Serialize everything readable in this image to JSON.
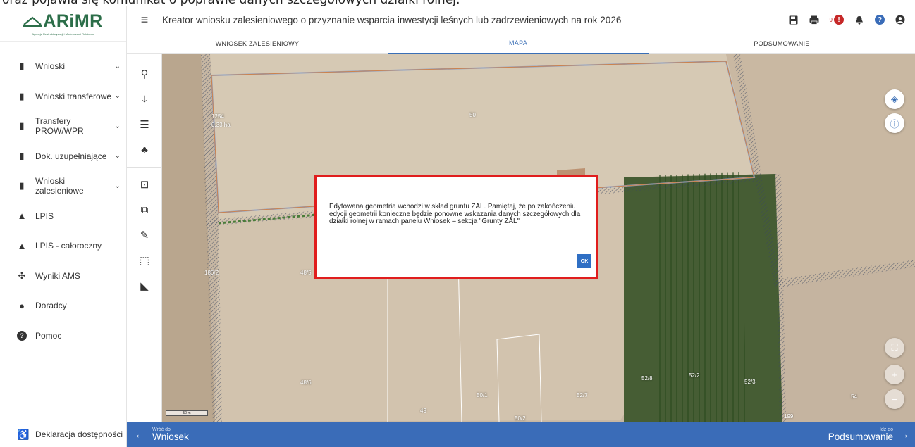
{
  "caption": "oraz pojawia się komunikat o poprawie danych szczegółowych działki rolnej:",
  "logo": {
    "name": "ARiMR",
    "subtitle": "Agencja Restrukturyzacji i Modernizacji Rolnictwa"
  },
  "header": {
    "title": "Kreator wniosku zalesieniowego o przyznanie wsparcia inwestycji leśnych lub zadrzewieniowych na rok 2026",
    "notification_count": "9"
  },
  "tabs": [
    {
      "label": "WNIOSEK ZALESIENIOWY",
      "active": false
    },
    {
      "label": "MAPA",
      "active": true
    },
    {
      "label": "PODSUMOWANIE",
      "active": false
    }
  ],
  "sidebar": {
    "items": [
      {
        "label": "Wnioski",
        "icon": "clipboard-icon",
        "expandable": true
      },
      {
        "label": "Wnioski transferowe",
        "icon": "clipboard-icon",
        "expandable": true
      },
      {
        "label": "Transfery PROW/WPR",
        "icon": "clipboard-icon",
        "expandable": true
      },
      {
        "label": "Dok. uzupełniające",
        "icon": "clipboard-icon",
        "expandable": true
      },
      {
        "label": "Wnioski zalesieniowe",
        "icon": "clipboard-icon",
        "expandable": true
      },
      {
        "label": "LPIS",
        "icon": "mountain-icon",
        "expandable": false
      },
      {
        "label": "LPIS - całoroczny",
        "icon": "mountain-icon",
        "expandable": false
      },
      {
        "label": "Wyniki AMS",
        "icon": "satellite-icon",
        "expandable": false
      },
      {
        "label": "Doradcy",
        "icon": "user-icon",
        "expandable": false
      },
      {
        "label": "Pomoc",
        "icon": "help-icon",
        "expandable": false
      }
    ],
    "accessibility": "Deklaracja dostępności"
  },
  "toolbar": [
    {
      "icon": "search-icon",
      "glyph": "⚲"
    },
    {
      "icon": "download-icon",
      "glyph": "⤓"
    },
    {
      "icon": "list-icon",
      "glyph": "☰"
    },
    {
      "icon": "forest-icon",
      "glyph": "♣"
    },
    {
      "icon": "select-area-icon",
      "glyph": "⊡"
    },
    {
      "icon": "copy-geometry-icon",
      "glyph": "⧉"
    },
    {
      "icon": "pencil-icon",
      "glyph": "✎"
    },
    {
      "icon": "rectangle-select-icon",
      "glyph": "⬚"
    },
    {
      "icon": "measure-icon",
      "glyph": "◣"
    }
  ],
  "map": {
    "parcel_labels": [
      "1254",
      "0,33 ha",
      "50",
      "186/2",
      "48/5",
      "48/6",
      "49",
      "50/1",
      "50/2",
      "52/7",
      "52/8",
      "52/2",
      "52/3",
      "54",
      "199"
    ],
    "scale_label": "50 m"
  },
  "modal": {
    "message": "Edytowana geometria wchodzi w skład gruntu ZAL. Pamiętaj, że po zakończeniu edycji geometrii konieczne będzie ponowne wskazania danych szczegółowych dla działki rolnej w ramach panelu Wniosek – sekcja \"Grunty ZAL\"",
    "ok_label": "OK"
  },
  "footer": {
    "back_small": "Wróć do",
    "back_big": "Wniosek",
    "next_small": "Idź do",
    "next_big": "Podsumowanie"
  },
  "colors": {
    "accent": "#3a6cb8",
    "modal_border": "#e01d1d",
    "brand_green": "#2c6e49"
  }
}
